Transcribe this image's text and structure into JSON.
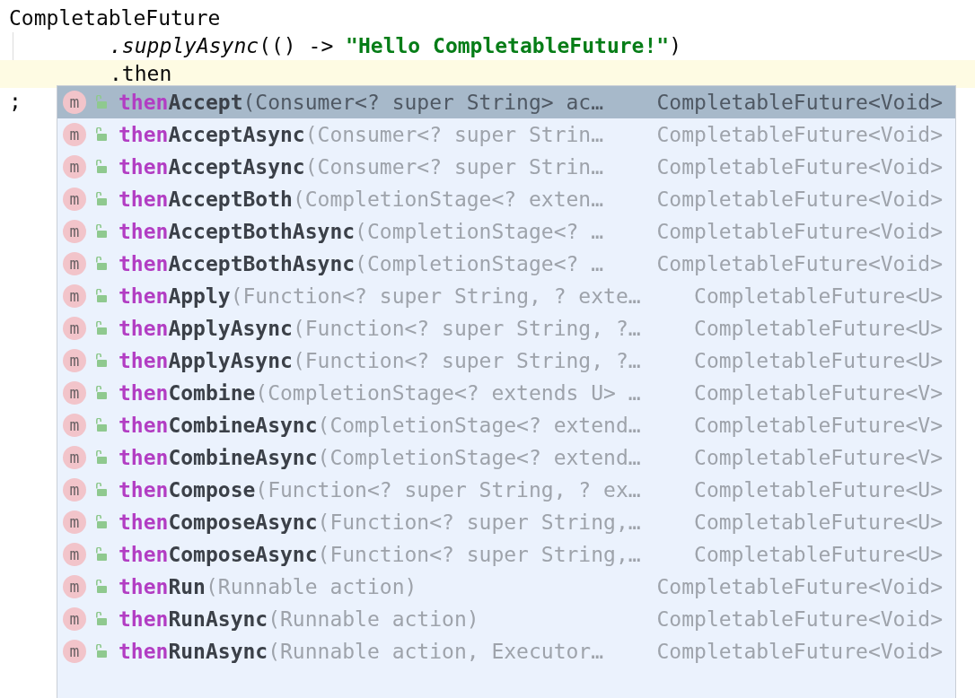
{
  "editor": {
    "lines": [
      {
        "indented": false,
        "current": false,
        "segments": [
          {
            "kind": "plain",
            "text": "CompletableFuture"
          }
        ]
      },
      {
        "indented": true,
        "current": false,
        "segments": [
          {
            "kind": "static-call",
            "text": ".supplyAsync"
          },
          {
            "kind": "plain",
            "text": "(() -> "
          },
          {
            "kind": "string",
            "text": "\"Hello CompletableFuture!\""
          },
          {
            "kind": "plain",
            "text": ")"
          }
        ]
      },
      {
        "indented": true,
        "current": true,
        "segments": [
          {
            "kind": "plain",
            "text": ".then"
          }
        ]
      },
      {
        "indented": false,
        "current": false,
        "segments": [
          {
            "kind": "plain",
            "text": ";"
          }
        ]
      }
    ]
  },
  "completion": {
    "items": [
      {
        "icon_letter": "m",
        "match": "then",
        "name": "Accept",
        "params": "(Consumer<? super String> ac…",
        "type": "CompletableFuture<Void>",
        "selected": true
      },
      {
        "icon_letter": "m",
        "match": "then",
        "name": "AcceptAsync",
        "params": "(Consumer<? super Strin…",
        "type": "CompletableFuture<Void>",
        "selected": false
      },
      {
        "icon_letter": "m",
        "match": "then",
        "name": "AcceptAsync",
        "params": "(Consumer<? super Strin…",
        "type": "CompletableFuture<Void>",
        "selected": false
      },
      {
        "icon_letter": "m",
        "match": "then",
        "name": "AcceptBoth",
        "params": "(CompletionStage<? exten…",
        "type": "CompletableFuture<Void>",
        "selected": false
      },
      {
        "icon_letter": "m",
        "match": "then",
        "name": "AcceptBothAsync",
        "params": "(CompletionStage<? …",
        "type": "CompletableFuture<Void>",
        "selected": false
      },
      {
        "icon_letter": "m",
        "match": "then",
        "name": "AcceptBothAsync",
        "params": "(CompletionStage<? …",
        "type": "CompletableFuture<Void>",
        "selected": false
      },
      {
        "icon_letter": "m",
        "match": "then",
        "name": "Apply",
        "params": "(Function<? super String, ? exte…",
        "type": "CompletableFuture<U>",
        "selected": false
      },
      {
        "icon_letter": "m",
        "match": "then",
        "name": "ApplyAsync",
        "params": "(Function<? super String, ?…",
        "type": "CompletableFuture<U>",
        "selected": false
      },
      {
        "icon_letter": "m",
        "match": "then",
        "name": "ApplyAsync",
        "params": "(Function<? super String, ?…",
        "type": "CompletableFuture<U>",
        "selected": false
      },
      {
        "icon_letter": "m",
        "match": "then",
        "name": "Combine",
        "params": "(CompletionStage<? extends U> …",
        "type": "CompletableFuture<V>",
        "selected": false
      },
      {
        "icon_letter": "m",
        "match": "then",
        "name": "CombineAsync",
        "params": "(CompletionStage<? extend…",
        "type": "CompletableFuture<V>",
        "selected": false
      },
      {
        "icon_letter": "m",
        "match": "then",
        "name": "CombineAsync",
        "params": "(CompletionStage<? extend…",
        "type": "CompletableFuture<V>",
        "selected": false
      },
      {
        "icon_letter": "m",
        "match": "then",
        "name": "Compose",
        "params": "(Function<? super String, ? ex…",
        "type": "CompletableFuture<U>",
        "selected": false
      },
      {
        "icon_letter": "m",
        "match": "then",
        "name": "ComposeAsync",
        "params": "(Function<? super String,…",
        "type": "CompletableFuture<U>",
        "selected": false
      },
      {
        "icon_letter": "m",
        "match": "then",
        "name": "ComposeAsync",
        "params": "(Function<? super String,…",
        "type": "CompletableFuture<U>",
        "selected": false
      },
      {
        "icon_letter": "m",
        "match": "then",
        "name": "Run",
        "params": "(Runnable action)",
        "type": "CompletableFuture<Void>",
        "selected": false
      },
      {
        "icon_letter": "m",
        "match": "then",
        "name": "RunAsync",
        "params": "(Runnable action)",
        "type": "CompletableFuture<Void>",
        "selected": false
      },
      {
        "icon_letter": "m",
        "match": "then",
        "name": "RunAsync",
        "params": "(Runnable action, Executor…",
        "type": "CompletableFuture<Void>",
        "selected": false
      }
    ]
  }
}
